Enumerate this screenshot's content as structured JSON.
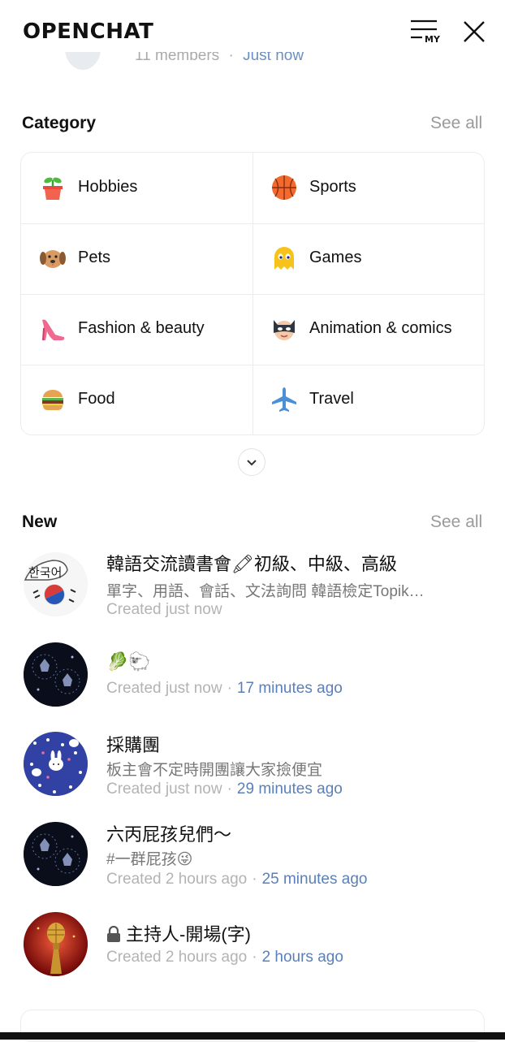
{
  "header": {
    "logo": "OPENCHAT",
    "my_label": "MY"
  },
  "peek": {
    "members": "11 members",
    "sep": "·",
    "time": "Just now"
  },
  "category": {
    "title": "Category",
    "see_all": "See all",
    "items": [
      {
        "label": "Hobbies",
        "icon": "plant-pot-icon"
      },
      {
        "label": "Sports",
        "icon": "basketball-icon"
      },
      {
        "label": "Pets",
        "icon": "dog-icon"
      },
      {
        "label": "Games",
        "icon": "ghost-icon"
      },
      {
        "label": "Fashion & beauty",
        "icon": "high-heel-icon"
      },
      {
        "label": "Animation & comics",
        "icon": "masked-hero-icon"
      },
      {
        "label": "Food",
        "icon": "burger-icon"
      },
      {
        "label": "Travel",
        "icon": "airplane-icon"
      }
    ]
  },
  "new": {
    "title": "New",
    "see_all": "See all",
    "items": [
      {
        "name": "韓語交流讀書會🖍初級、中級、高級",
        "desc": "單字、用語、會話、文法詢問 韓語檢定Topik…",
        "created": "Created just now",
        "updated": ""
      },
      {
        "name": "🥬🐑",
        "desc": "",
        "created": "Created just now",
        "updated": "17 minutes ago"
      },
      {
        "name": "採購團",
        "desc": "板主會不定時開團讓大家撿便宜",
        "created": "Created just now",
        "updated": "29 minutes ago"
      },
      {
        "name": "六丙屁孩兒們〜",
        "desc": "#一群屁孩😜",
        "created": "Created 2 hours ago",
        "updated": "25 minutes ago"
      },
      {
        "name": "主持人-開場(字)",
        "desc": "",
        "created": "Created 2 hours ago",
        "updated": "2 hours ago"
      }
    ],
    "separator": "·"
  },
  "colors": {
    "accent_blue": "#5a7fb9",
    "muted": "#b3b3b3",
    "see_all": "#9a9a9a"
  }
}
